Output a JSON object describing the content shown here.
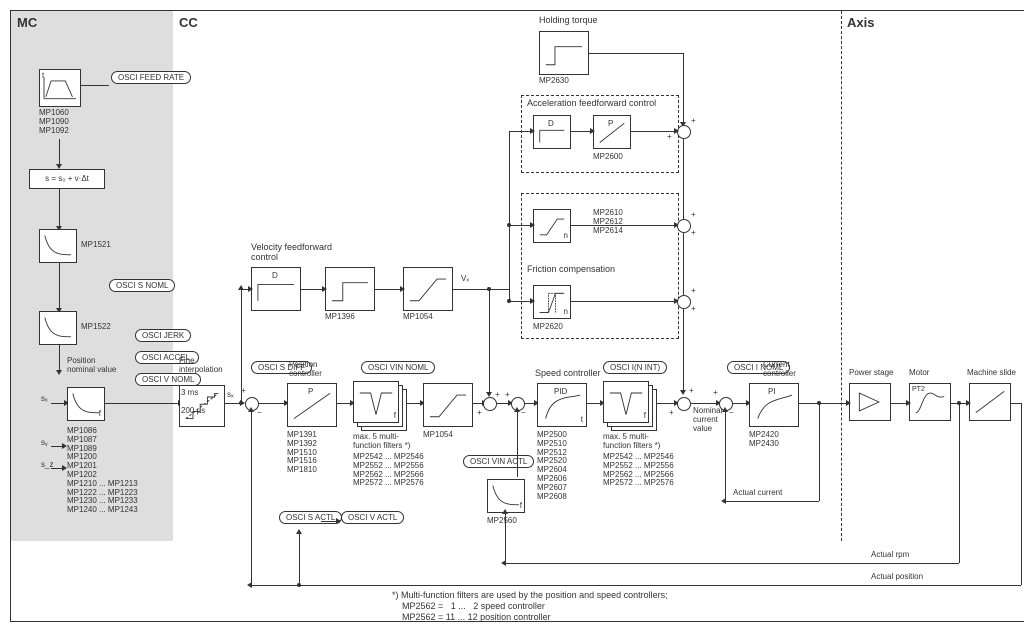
{
  "sections": {
    "mc": "MC",
    "cc": "CC",
    "axis": "Axis"
  },
  "mc": {
    "osci_feedrate": "OSCI\nFEED RATE",
    "mp_group1": "MP1060\nMP1090\nMP1092",
    "eqn": "s = s₀ + v·Δt",
    "mp1521": "MP1521",
    "mp1522": "MP1522",
    "osci_snoml": "OSCI\nS NOML",
    "osci_jerk": "OSCI\nJERK",
    "osci_accel": "OSCI\nACCEL.",
    "osci_vnoml": "OSCI\nV NOML",
    "pos_nom_val": "Position\nnominal value",
    "sx": "sₓ",
    "sy": "sᵧ",
    "sz": "s_z",
    "mp_list": "MP1086\nMP1087\nMP1089\nMP1200\nMP1201\nMP1202\nMP1210 ... MP1213\nMP1222 ... MP1223\nMP1230 ... MP1233\nMP1240 ... MP1243"
  },
  "cc": {
    "holding_torque": "Holding torque",
    "mp2630": "MP2630",
    "accel_ff": "Acceleration feedforward control",
    "mp2600": "MP2600",
    "mp_group_accel": "MP2610\nMP2612\nMP2614",
    "friction_comp": "Friction compensation",
    "mp2620": "MP2620",
    "vel_ff": "Velocity feedforward\ncontrol",
    "mp1396": "MP1396",
    "mp1054a": "MP1054",
    "vx": "Vₓ",
    "fine_interp": "Fine\ninterpolation",
    "fine_vals": "3 ms\n\n200 µs",
    "osci_sdiff": "OSCI\nS DIFF",
    "pos_ctrl": "Position\ncontroller",
    "pos_mp": "MP1391\nMP1392\nMP1510\nMP1516\nMP1810",
    "osci_vinnoml": "OSCI\nVIN NOML",
    "multifilter": "max. 5 multi-\nfunction filters *)",
    "multifilter_mp": "MP2542 ... MP2546\nMP2552 ... MP2556\nMP2562 ... MP2566\nMP2572 ... MP2576",
    "mp1054b": "MP1054",
    "osci_vinactl": "OSCI\nVIN ACTL",
    "mp2560": "MP2560",
    "speed_ctrl": "Speed controller",
    "speed_mp": "MP2500\nMP2510\nMP2512\nMP2520\nMP2604\nMP2606\nMP2607\nMP2608",
    "osci_inint": "OSCI\nI(N INT)",
    "multifilter2_mp": "MP2542 ... MP2546\nMP2552 ... MP2556\nMP2562 ... MP2566\nMP2572 ... MP2576",
    "osci_sactl": "OSCI\nS ACTL",
    "osci_vactl": "OSCI\nV ACTL",
    "nom_cur_val": "Nominal\ncurrent\nvalue",
    "osci_inoml": "OSCI\nI NOML",
    "cur_ctrl": "Current\ncontroller",
    "mp_cur": "MP2420\nMP2430",
    "actual_current": "Actual current",
    "actual_rpm": "Actual rpm",
    "actual_position": "Actual position",
    "D": "D",
    "P": "P",
    "PID": "PID",
    "PI": "PI",
    "n": "n",
    "f": "f",
    "t": "t",
    "pt2": "PT2"
  },
  "axis": {
    "power_stage": "Power stage",
    "motor": "Motor",
    "machine_slide": "Machine slide"
  },
  "footnote": "*) Multi-function filters are used by the position and speed controllers;\n    MP2562 =   1 ...   2 speed controller\n    MP2562 = 11 ... 12 position controller"
}
